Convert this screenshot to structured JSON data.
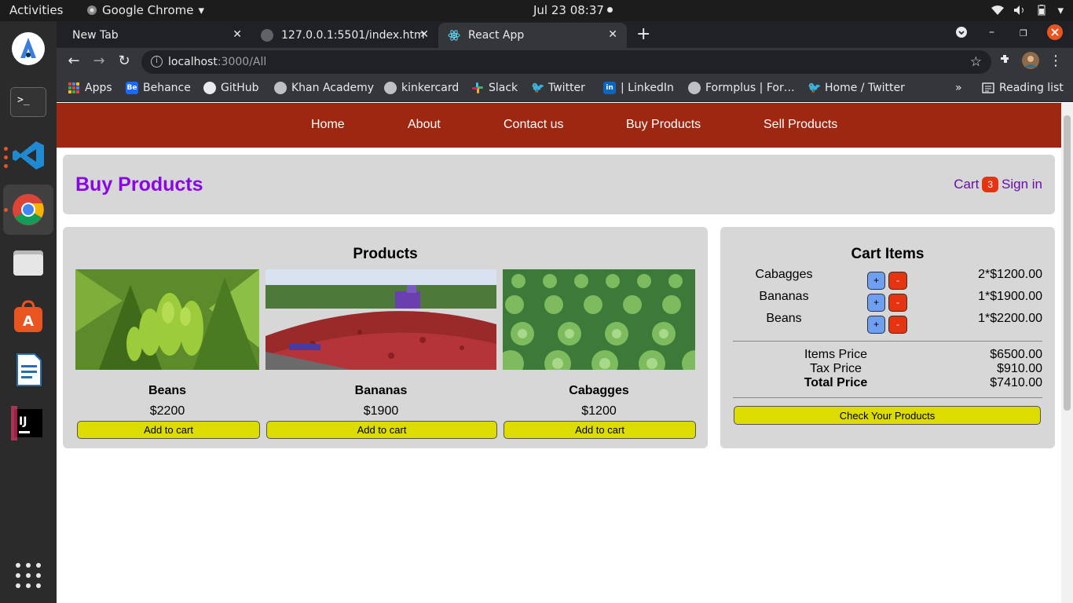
{
  "system": {
    "activities": "Activities",
    "app_name": "Google Chrome",
    "clock": "Jul 23  08:37"
  },
  "tabs": [
    {
      "label": "New Tab"
    },
    {
      "label": "127.0.0.1:5501/index.htm"
    },
    {
      "label": "React App"
    }
  ],
  "address": {
    "host": "localhost",
    "path": ":3000/All"
  },
  "bookmarks": [
    {
      "label": "Apps",
      "icon": "apps-grid-icon"
    },
    {
      "label": "Behance",
      "icon": "behance-icon"
    },
    {
      "label": "GitHub",
      "icon": "github-icon"
    },
    {
      "label": "Khan Academy",
      "icon": "globe-icon"
    },
    {
      "label": "kinkercard",
      "icon": "globe-icon"
    },
    {
      "label": "Slack",
      "icon": "slack-icon"
    },
    {
      "label": "Twitter",
      "icon": "twitter-icon"
    },
    {
      "label": "| LinkedIn",
      "icon": "linkedin-icon"
    },
    {
      "label": "Formplus | For…",
      "icon": "globe-icon"
    },
    {
      "label": "Home / Twitter",
      "icon": "twitter-icon"
    }
  ],
  "reading_list": "Reading list",
  "nav": {
    "home": "Home",
    "about": "About",
    "contact": "Contact us",
    "buy": "Buy Products",
    "sell": "Sell Products"
  },
  "header": {
    "title": "Buy Products",
    "cart": "Cart",
    "cart_count": "3",
    "signin": "Sign in"
  },
  "products": {
    "title": "Products",
    "items": [
      {
        "name": "Beans",
        "price": "$2200",
        "button": "Add to cart"
      },
      {
        "name": "Bananas",
        "price": "$1900",
        "button": "Add to cart"
      },
      {
        "name": "Cabagges",
        "price": "$1200",
        "button": "Add to cart"
      }
    ]
  },
  "cart": {
    "title": "Cart Items",
    "items": [
      {
        "name": "Cabagges",
        "qty": "2*$1200.00",
        "plus": "+",
        "minus": "-"
      },
      {
        "name": "Bananas",
        "qty": "1*$1900.00",
        "plus": "+",
        "minus": "-"
      },
      {
        "name": "Beans",
        "qty": "1*$2200.00",
        "plus": "+",
        "minus": "-"
      }
    ],
    "items_price_label": "Items Price",
    "items_price": "$6500.00",
    "tax_label": "Tax Price",
    "tax": "$910.00",
    "total_label": "Total Price",
    "total": "$7410.00",
    "check_button": "Check Your Products"
  },
  "colors": {
    "nav_bg": "#9e2712",
    "title": "#8a06e6",
    "button_yellow": "#dcdc00",
    "plus_blue": "#6f9ff0",
    "minus_red": "#e63312"
  }
}
